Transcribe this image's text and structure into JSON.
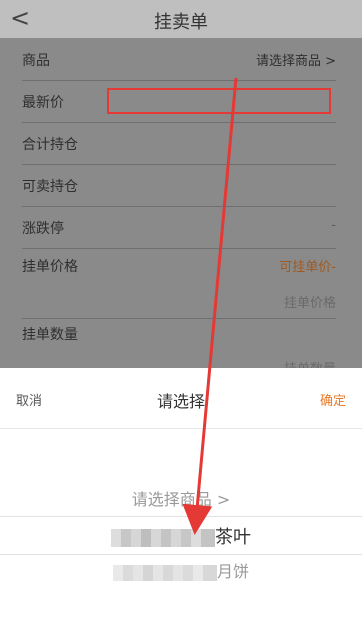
{
  "header": {
    "back_label": "<",
    "title": "挂卖单"
  },
  "form": {
    "rows": [
      {
        "label": "商品",
        "value": "请选择商品 >"
      },
      {
        "label": "最新价",
        "value": ""
      },
      {
        "label": "合计持仓",
        "value": ""
      },
      {
        "label": "可卖持仓",
        "value": ""
      },
      {
        "label": "涨跌停",
        "value": "-"
      },
      {
        "label": "挂单价格",
        "value": "可挂单价-",
        "placeholder": "挂单价格"
      },
      {
        "label": "挂单数量",
        "placeholder": "挂单数量"
      }
    ]
  },
  "picker": {
    "cancel": "取消",
    "title": "请选择",
    "confirm": "确定",
    "options": [
      {
        "text": "请选择商品 >"
      },
      {
        "suffix": "茶叶"
      },
      {
        "suffix": "月饼"
      }
    ]
  },
  "colors": {
    "accent_orange": "#e87a2a",
    "highlight_red": "#e53935"
  }
}
